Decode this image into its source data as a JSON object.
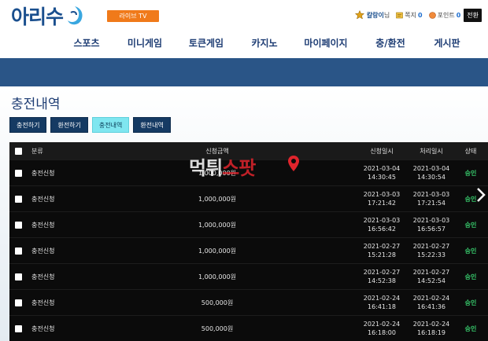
{
  "brand": {
    "logo_text": "아리수",
    "live_tv": "라이브 TV"
  },
  "user": {
    "nickname": "칼랑이",
    "suffix": "님",
    "notes_label": "쪽지",
    "notes_count": "0",
    "points_label": "포인트",
    "points_value": "0",
    "convert_label": "전환"
  },
  "nav": [
    "스포츠",
    "미니게임",
    "토큰게임",
    "카지노",
    "마이페이지",
    "충/환전",
    "게시판"
  ],
  "page_title": "충전내역",
  "tabs": [
    {
      "label": "충전하기",
      "active": false
    },
    {
      "label": "환전하기",
      "active": false
    },
    {
      "label": "충전내역",
      "active": true
    },
    {
      "label": "환전내역",
      "active": false
    }
  ],
  "table": {
    "headers": {
      "type": "분류",
      "amount": "신청금액",
      "request_date": "신청일시",
      "process_date": "처리일시",
      "status": "상태"
    },
    "rows": [
      {
        "type": "충전신청",
        "amount": "1,000,000원",
        "req_d": "2021-03-04",
        "req_t": "14:30:45",
        "proc_d": "2021-03-04",
        "proc_t": "14:30:54",
        "status": "승인"
      },
      {
        "type": "충전신청",
        "amount": "1,000,000원",
        "req_d": "2021-03-03",
        "req_t": "17:21:42",
        "proc_d": "2021-03-03",
        "proc_t": "17:21:54",
        "status": "승인"
      },
      {
        "type": "충전신청",
        "amount": "1,000,000원",
        "req_d": "2021-03-03",
        "req_t": "16:56:42",
        "proc_d": "2021-03-03",
        "proc_t": "16:56:57",
        "status": "승인"
      },
      {
        "type": "충전신청",
        "amount": "1,000,000원",
        "req_d": "2021-02-27",
        "req_t": "15:21:28",
        "proc_d": "2021-02-27",
        "proc_t": "15:22:33",
        "status": "승인"
      },
      {
        "type": "충전신청",
        "amount": "1,000,000원",
        "req_d": "2021-02-27",
        "req_t": "14:52:38",
        "proc_d": "2021-02-27",
        "proc_t": "14:52:54",
        "status": "승인"
      },
      {
        "type": "충전신청",
        "amount": "500,000원",
        "req_d": "2021-02-24",
        "req_t": "16:41:18",
        "proc_d": "2021-02-24",
        "proc_t": "16:41:36",
        "status": "승인"
      },
      {
        "type": "충전신청",
        "amount": "500,000원",
        "req_d": "2021-02-24",
        "req_t": "16:18:00",
        "proc_d": "2021-02-24",
        "proc_t": "16:18:19",
        "status": "승인"
      }
    ]
  },
  "watermark": {
    "part1": "먹튀",
    "part2": "스팟"
  },
  "colors": {
    "nav_text": "#1e3d74",
    "banner": "#2a5587",
    "tab_active": "#7fe6f0",
    "status_ok": "#37c86b",
    "live_tv": "#f07a1a"
  },
  "icons": {
    "logo": "water-drop-swoosh-icon",
    "rank": "star-icon",
    "notes": "note-icon",
    "points": "coin-icon",
    "next": "chevron-right-icon",
    "watermark_pin": "location-pin-icon"
  }
}
